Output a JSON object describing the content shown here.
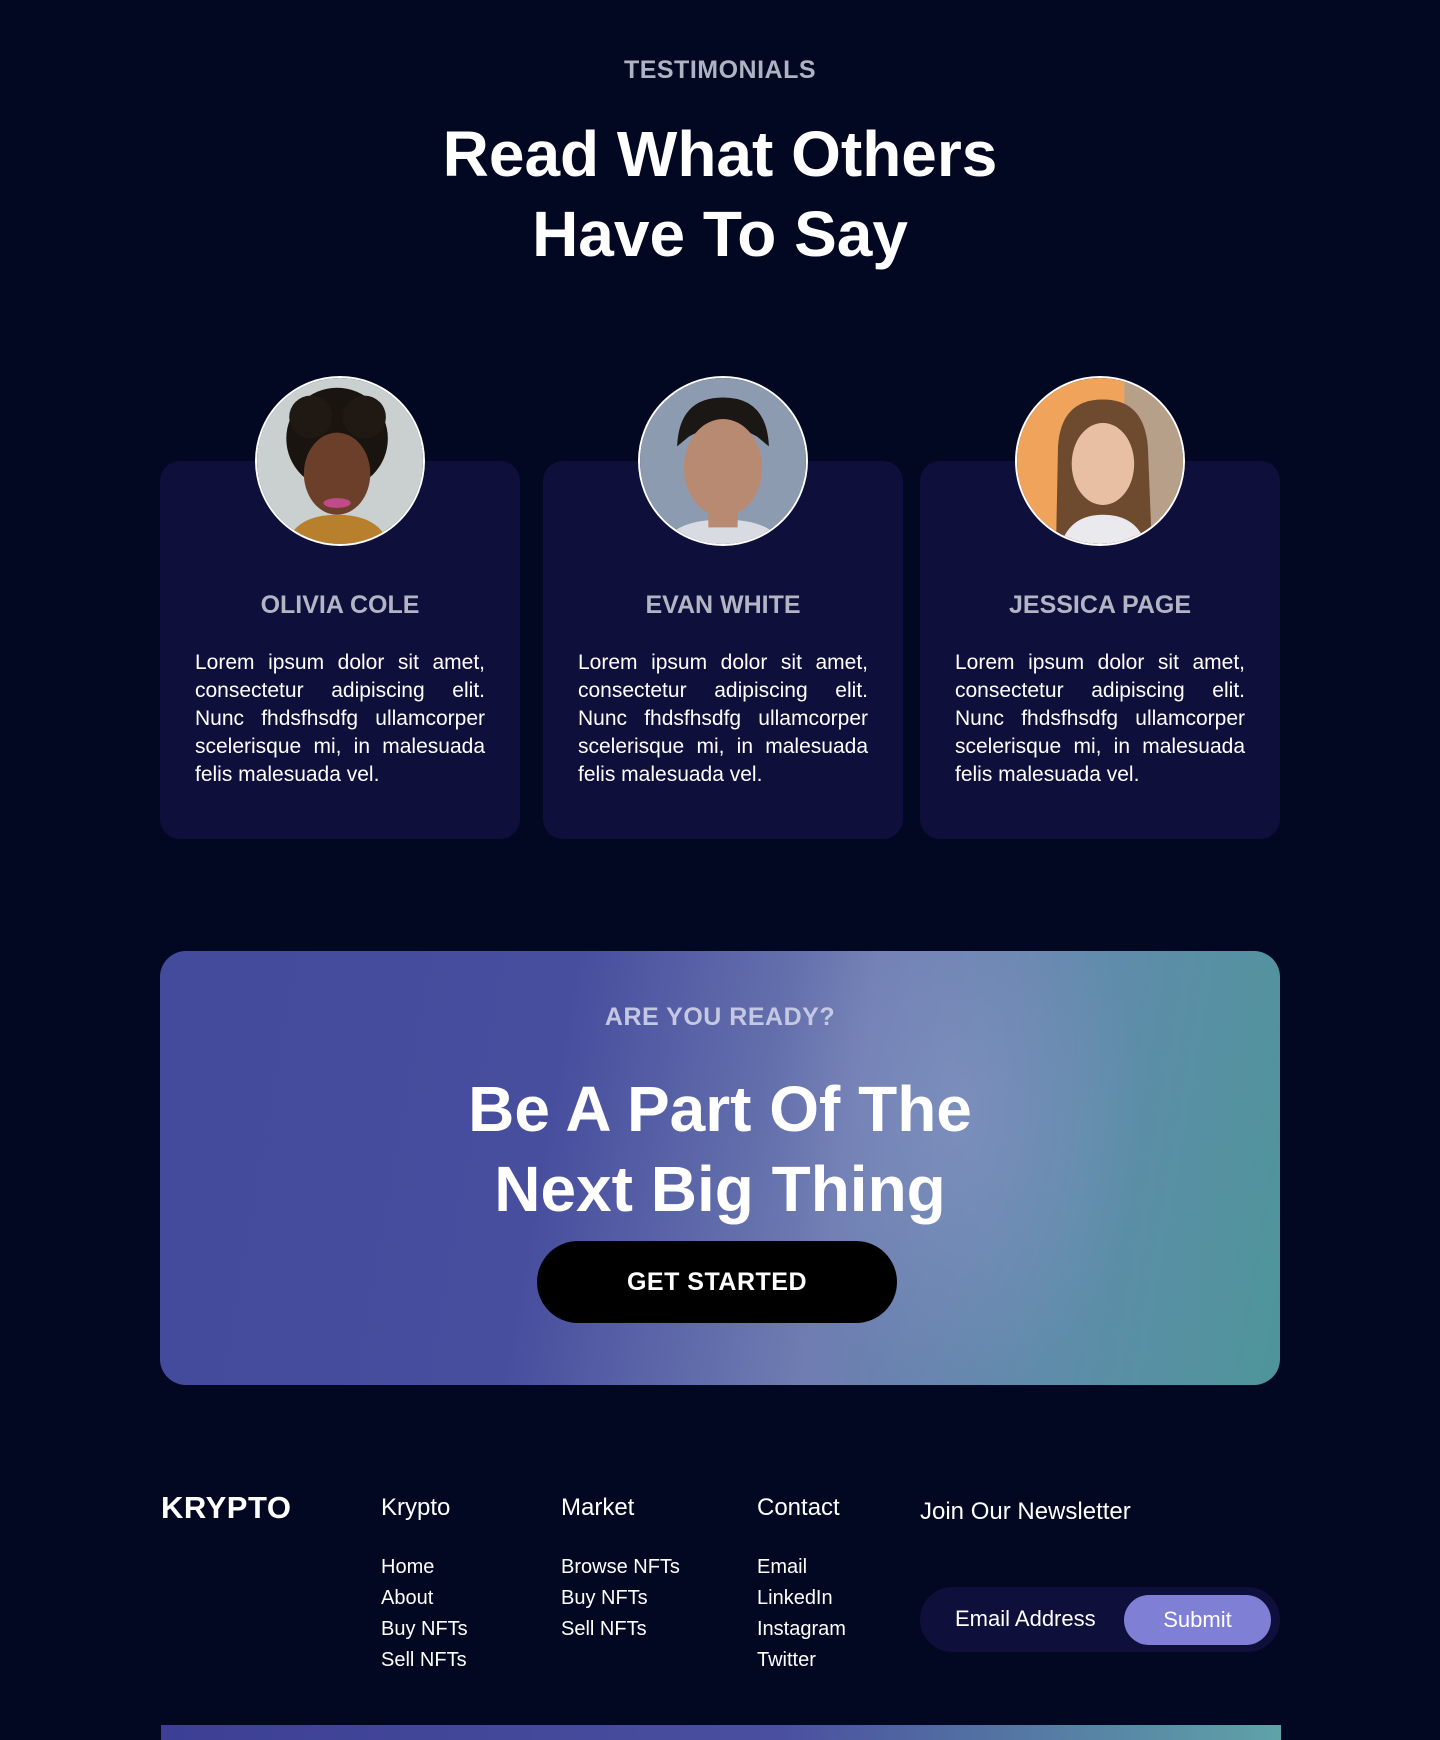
{
  "testimonials": {
    "eyebrow": "TESTIMONIALS",
    "title_line1": "Read What Others",
    "title_line2": "Have To Say",
    "items": [
      {
        "name": "OLIVIA COLE",
        "text": "Lorem ipsum dolor sit amet, consectetur adipiscing elit. Nunc fhdsfhsdfg ullamcorper scelerisque mi, in malesuada felis malesuada vel."
      },
      {
        "name": "EVAN WHITE",
        "text": "Lorem ipsum dolor sit amet, consectetur adipiscing elit. Nunc fhdsfhsdfg ullamcorper scelerisque mi, in malesuada felis malesuada vel."
      },
      {
        "name": "JESSICA PAGE",
        "text": "Lorem ipsum dolor sit amet, consectetur adipiscing elit. Nunc fhdsfhsdfg ullamcorper scelerisque mi, in malesuada felis malesuada vel."
      }
    ]
  },
  "cta": {
    "eyebrow": "ARE YOU READY?",
    "title_line1": "Be A Part Of The",
    "title_line2": "Next Big Thing",
    "button_label": "GET STARTED"
  },
  "footer": {
    "logo": "KRYPTO",
    "columns": [
      {
        "heading": "Krypto",
        "links": [
          "Home",
          "About",
          "Buy NFTs",
          "Sell NFTs"
        ]
      },
      {
        "heading": "Market",
        "links": [
          "Browse NFTs",
          "Buy NFTs",
          "Sell NFTs"
        ]
      },
      {
        "heading": "Contact",
        "links": [
          "Email",
          "LinkedIn",
          "Instagram",
          "Twitter"
        ]
      }
    ],
    "newsletter": {
      "heading": "Join Our Newsletter",
      "placeholder": "Email Address",
      "submit_label": "Submit"
    }
  },
  "colors": {
    "page_background": "#020822",
    "card_background": "#0f0f3c",
    "button_dark": "#000000",
    "submit_accent": "#7f7fd6",
    "muted_text": "#b3b5c5"
  }
}
